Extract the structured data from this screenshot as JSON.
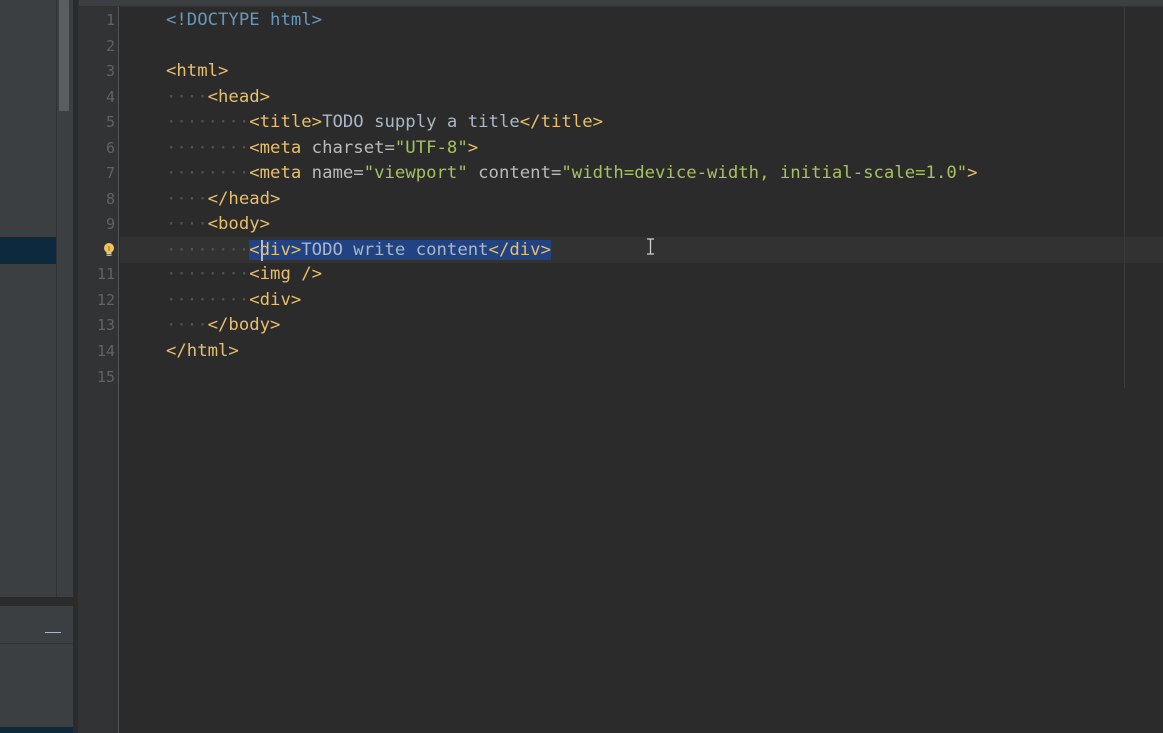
{
  "left_panel": {
    "minimize_label": ""
  },
  "gutter": {
    "line_numbers": [
      "1",
      "2",
      "3",
      "4",
      "5",
      "6",
      "7",
      "8",
      "9",
      "10",
      "11",
      "12",
      "13",
      "14",
      "15"
    ]
  },
  "code": {
    "line1": {
      "doctype": "<!DOCTYPE html>"
    },
    "line3": {
      "open": "<html>"
    },
    "line4": {
      "indent": "····",
      "open": "<head>"
    },
    "line5": {
      "indent": "········",
      "open": "<title>",
      "text": "TODO supply a title",
      "close": "</title>"
    },
    "line6": {
      "indent": "········",
      "tag": "<meta",
      "attr": " charset=",
      "value": "\"UTF-8\"",
      "end": ">"
    },
    "line7": {
      "indent": "········",
      "tag": "<meta",
      "attr1": " name=",
      "value1": "\"viewport\"",
      "attr2": " content=",
      "value2": "\"width=device-width, initial-scale=1.0\"",
      "end": ">"
    },
    "line8": {
      "indent": "····",
      "close": "</head>"
    },
    "line9": {
      "indent": "····",
      "open": "<body>"
    },
    "line10": {
      "indent": "········",
      "open": "<div>",
      "text": "TODO write content",
      "close": "</div>"
    },
    "line11": {
      "indent": "········",
      "tag": "<img",
      "end": " />"
    },
    "line12": {
      "indent": "········",
      "open": "<div>"
    },
    "line13": {
      "indent": "····",
      "close": "</body>"
    },
    "line14": {
      "close": "</html>"
    }
  },
  "colors": {
    "background": "#2b2b2b",
    "gutter": "#313335",
    "tag": "#e8bf6a",
    "string": "#a5c25c",
    "doctype": "#6897bb",
    "selection": "#214283",
    "current_line": "#323232"
  },
  "icons": [
    "fold-icon",
    "intention-bulb-icon",
    "text-cursor-icon",
    "minimize-icon"
  ]
}
